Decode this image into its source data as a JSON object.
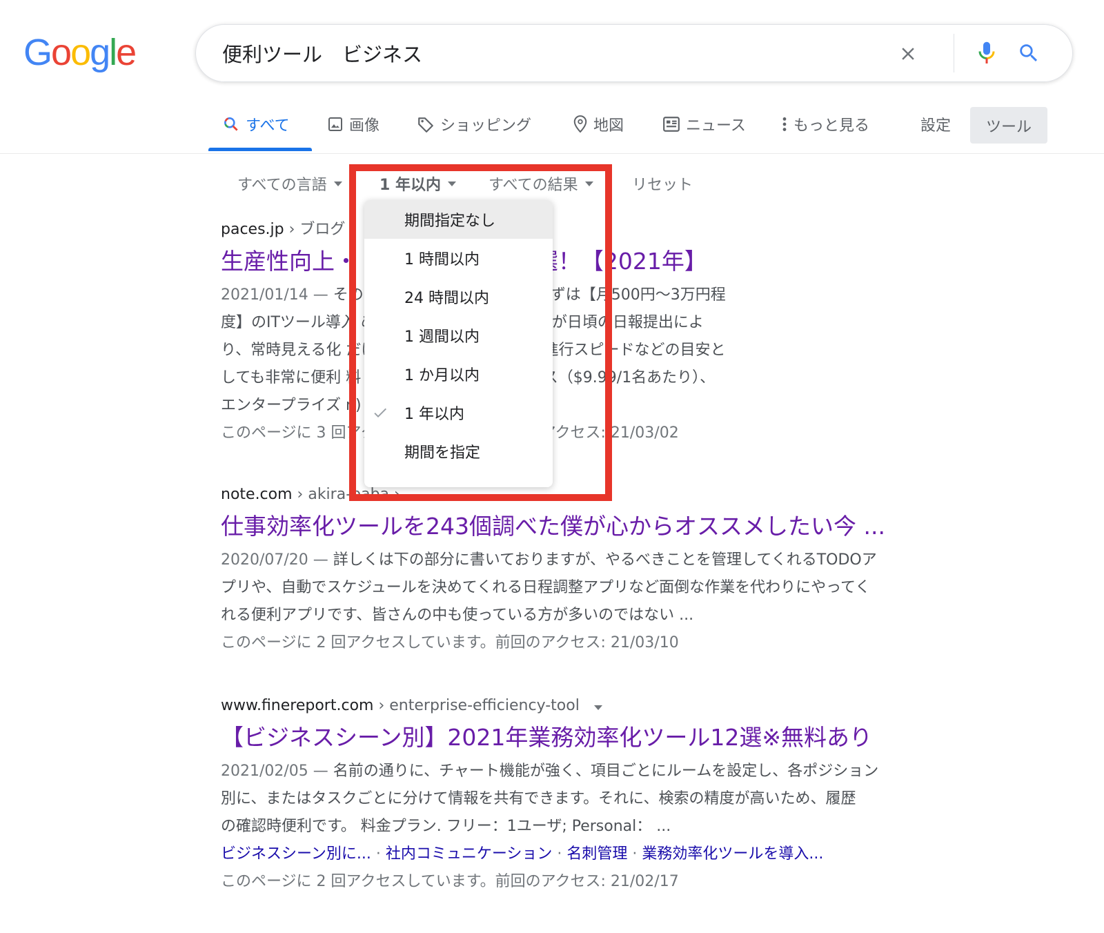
{
  "logo": {
    "letters": [
      "G",
      "o",
      "o",
      "g",
      "l",
      "e"
    ]
  },
  "search": {
    "query": "便利ツール　ビジネス"
  },
  "tabs": [
    {
      "label": "すべて",
      "icon": "search-icon"
    },
    {
      "label": "画像",
      "icon": "image-icon"
    },
    {
      "label": "ショッピング",
      "icon": "tag-icon"
    },
    {
      "label": "地図",
      "icon": "map-pin-icon"
    },
    {
      "label": "ニュース",
      "icon": "news-icon"
    },
    {
      "label": "もっと見る",
      "icon": "more-vert-icon"
    }
  ],
  "settings_label": "設定",
  "tools_label": "ツール",
  "filters": {
    "language": "すべての言語",
    "time": "1 年以内",
    "results": "すべての結果",
    "reset": "リセット"
  },
  "time_menu": {
    "items": [
      "期間指定なし",
      "1 時間以内",
      "24 時間以内",
      "1 週間以内",
      "1 か月以内",
      "1 年以内",
      "期間を指定"
    ],
    "selected": "1 年以内",
    "hovered": "期間指定なし"
  },
  "results": [
    {
      "domain": "paces.jp",
      "path": "› ブログ ›",
      "title": "生産性向上・… 適な ITツール12選！【2021年】",
      "title_visible": "生産性向上・ 適な ITツール12選！【2021年】",
      "snippet_date": "2021/01/14 — ",
      "snippet_lines": [
        "その                                    効率化を目指す際には、まずは【月500円〜3万円程",
        "度】のITツール導入                      めです！ ... ような採算状況が日頃の日報提出によ",
        "り、常時見える化                        だけの判断でなく、全体的な進行スピードなどの目安と",
        "しても非常に便利                        料・月額費用：ビジネスクラス（$9.99/1名あたり）、",
        "エンタープライズ                        n)"
      ],
      "visited": "このページに 3 回アクセスしています。前回のアクセス: 21/03/02"
    },
    {
      "domain": "note.com",
      "path": "› akira-baba ›",
      "title": "仕事効率化ツールを243個調べた僕が心からオススメしたい今 ...",
      "snippet_date": "2020/07/20 — ",
      "snippet_lines": [
        "詳しくは下の部分に書いておりますが、やるべきことを管理してくれるTODOア",
        "プリや、自動でスケジュールを決めてくれる日程調整アプリなど面倒な作業を代わりにやってく",
        "れる便利アプリです、皆さんの中も使っている方が多いのではない ..."
      ],
      "visited": "このページに 2 回アクセスしています。前回のアクセス: 21/03/10"
    },
    {
      "domain": "www.finereport.com",
      "path": "› enterprise-efficiency-tool",
      "title": "【ビジネスシーン別】2021年業務効率化ツール12選※無料あり",
      "snippet_date": "2021/02/05 — ",
      "snippet_lines": [
        "名前の通りに、チャート機能が強く、項目ごとにルームを設定し、各ポジション",
        "別に、またはタスクごとに分けて情報を共有できます。それに、検索の精度が高いため、履歴",
        "の確認時便利です。 料金プラン. フリー：1ユーザ; Personal： ..."
      ],
      "sitelinks": [
        "ビジネスシーン別に...",
        "社内コミュニケーション",
        "名刺管理",
        "業務効率化ツールを導入..."
      ],
      "visited": "このページに 2 回アクセスしています。前回のアクセス: 21/02/17"
    }
  ],
  "colors": {
    "accent": "#1a73e8",
    "visited_title": "#681da8",
    "link": "#1a0dab",
    "highlight": "#e7352a"
  }
}
